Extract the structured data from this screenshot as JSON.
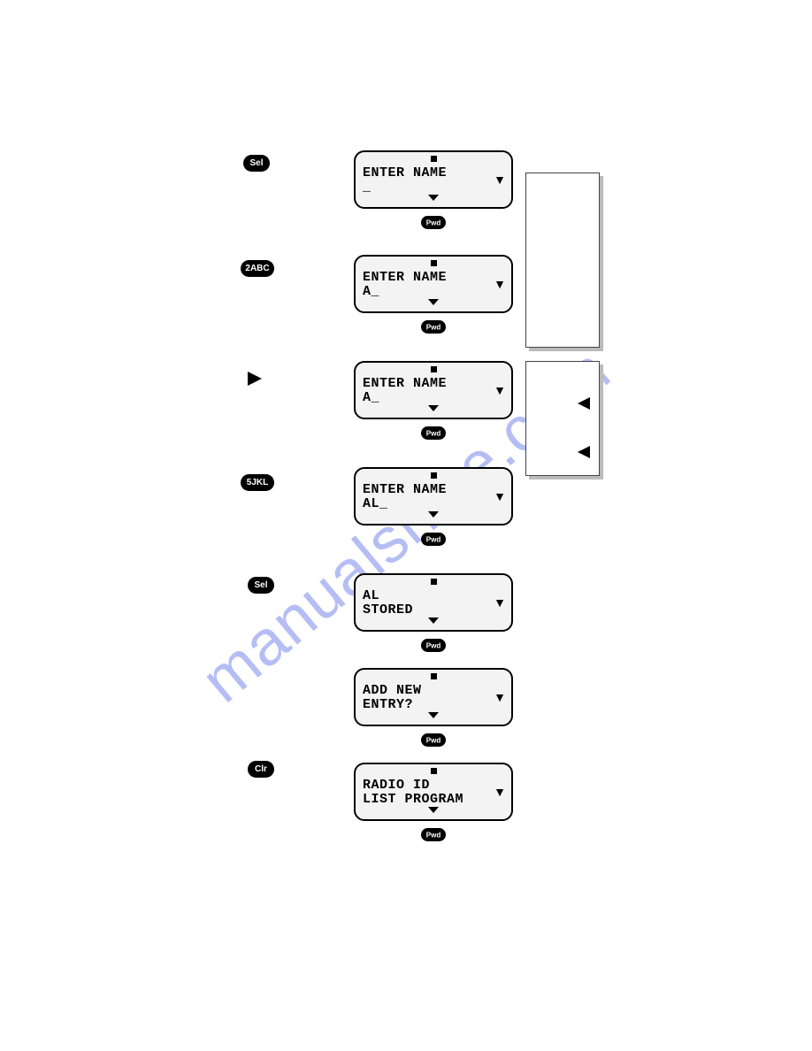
{
  "watermark": "manualsnive.com",
  "keys": {
    "sel": "Sel",
    "abc2": "2ABC",
    "jkl5": "5JKL",
    "clr": "Clr"
  },
  "pill_label": "Pwd",
  "screens": [
    {
      "line1": "ENTER NAME",
      "line2": "_"
    },
    {
      "line1": "ENTER NAME",
      "line2": "A_"
    },
    {
      "line1": "ENTER NAME",
      "line2": "A_"
    },
    {
      "line1": "ENTER NAME",
      "line2": "AL_"
    },
    {
      "line1": "AL",
      "line2": "STORED"
    },
    {
      "line1": "ADD NEW",
      "line2": "ENTRY?"
    },
    {
      "line1": "RADIO ID",
      "line2": "LIST PROGRAM"
    }
  ]
}
